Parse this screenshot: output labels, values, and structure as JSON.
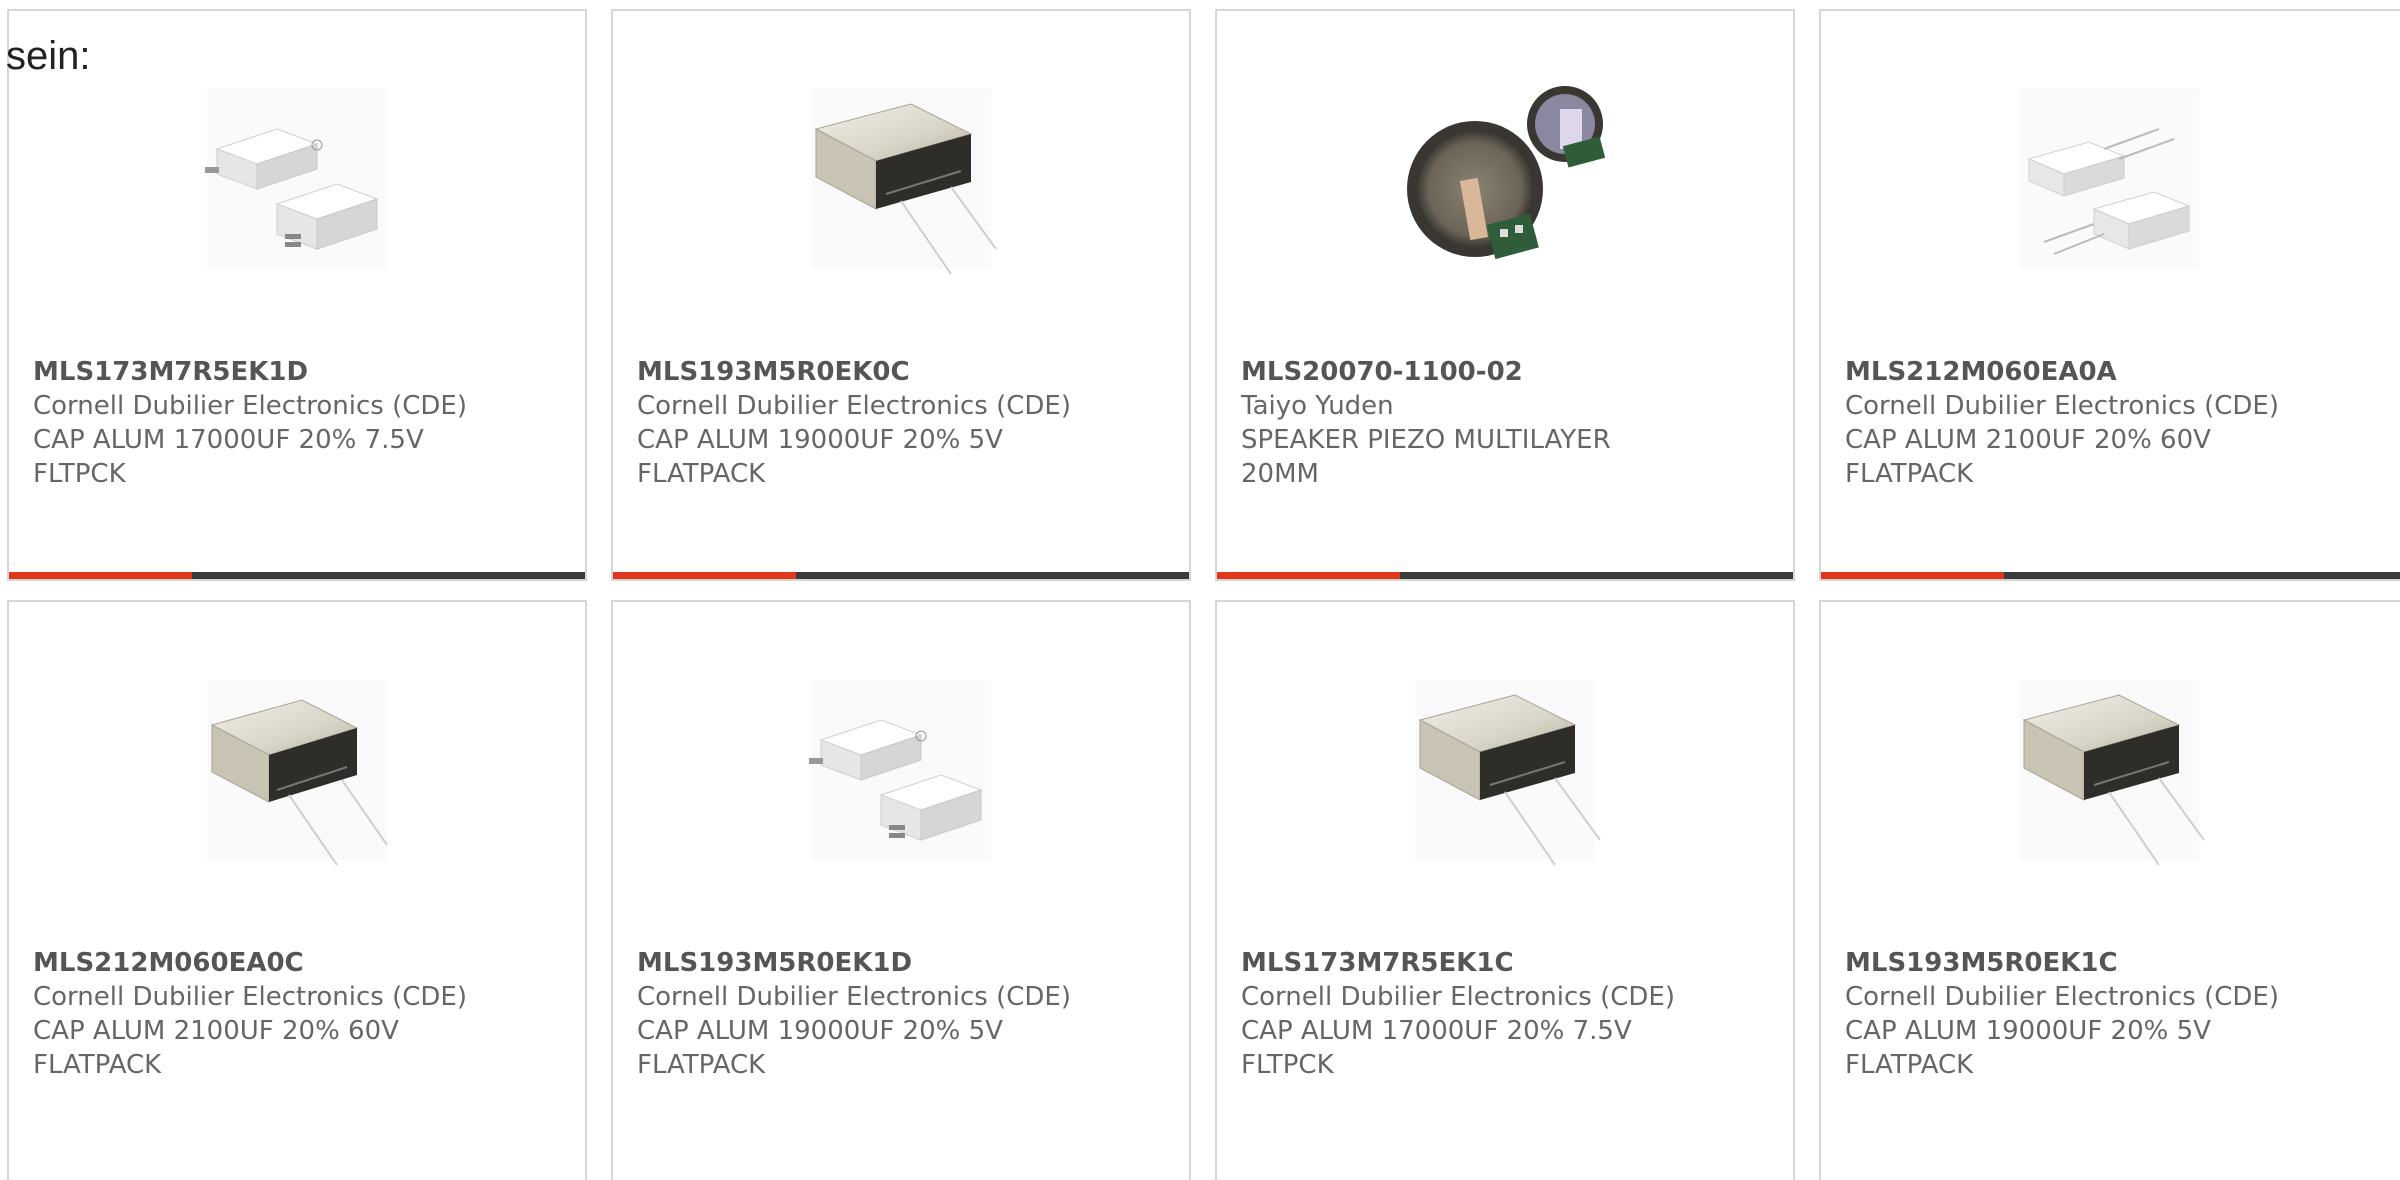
{
  "heading": "sein:",
  "accent_color": "#e0361c",
  "bar_color": "#3b3b3b",
  "cards": [
    {
      "part": "MLS173M7R5EK1D",
      "maker": "Cornell Dubilier Electronics (CDE)",
      "desc1": "CAP ALUM 17000UF 20% 7.5V",
      "desc2": "FLTPCK",
      "image": "flatpack-white-pair"
    },
    {
      "part": "MLS193M5R0EK0C",
      "maker": "Cornell Dubilier Electronics (CDE)",
      "desc1": "CAP ALUM 19000UF 20% 5V",
      "desc2": "FLATPACK",
      "image": "flatpack-metal-leads"
    },
    {
      "part": "MLS20070-1100-02",
      "maker": "Taiyo Yuden",
      "desc1": "SPEAKER PIEZO MULTILAYER",
      "desc2": "20MM",
      "image": "piezo-speaker-round"
    },
    {
      "part": "MLS212M060EA0A",
      "maker": "Cornell Dubilier Electronics (CDE)",
      "desc1": "CAP ALUM 2100UF 20% 60V",
      "desc2": "FLATPACK",
      "image": "flatpack-white-pins"
    },
    {
      "part": "MLS212M060EA0C",
      "maker": "Cornell Dubilier Electronics (CDE)",
      "desc1": "CAP ALUM 2100UF 20% 60V",
      "desc2": "FLATPACK",
      "image": "flatpack-metal-leads"
    },
    {
      "part": "MLS193M5R0EK1D",
      "maker": "Cornell Dubilier Electronics (CDE)",
      "desc1": "CAP ALUM 19000UF 20% 5V",
      "desc2": "FLATPACK",
      "image": "flatpack-white-pair"
    },
    {
      "part": "MLS173M7R5EK1C",
      "maker": "Cornell Dubilier Electronics (CDE)",
      "desc1": "CAP ALUM 17000UF 20% 7.5V",
      "desc2": "FLTPCK",
      "image": "flatpack-metal-leads"
    },
    {
      "part": "MLS193M5R0EK1C",
      "maker": "Cornell Dubilier Electronics (CDE)",
      "desc1": "CAP ALUM 19000UF 20% 5V",
      "desc2": "FLATPACK",
      "image": "flatpack-metal-leads"
    }
  ]
}
